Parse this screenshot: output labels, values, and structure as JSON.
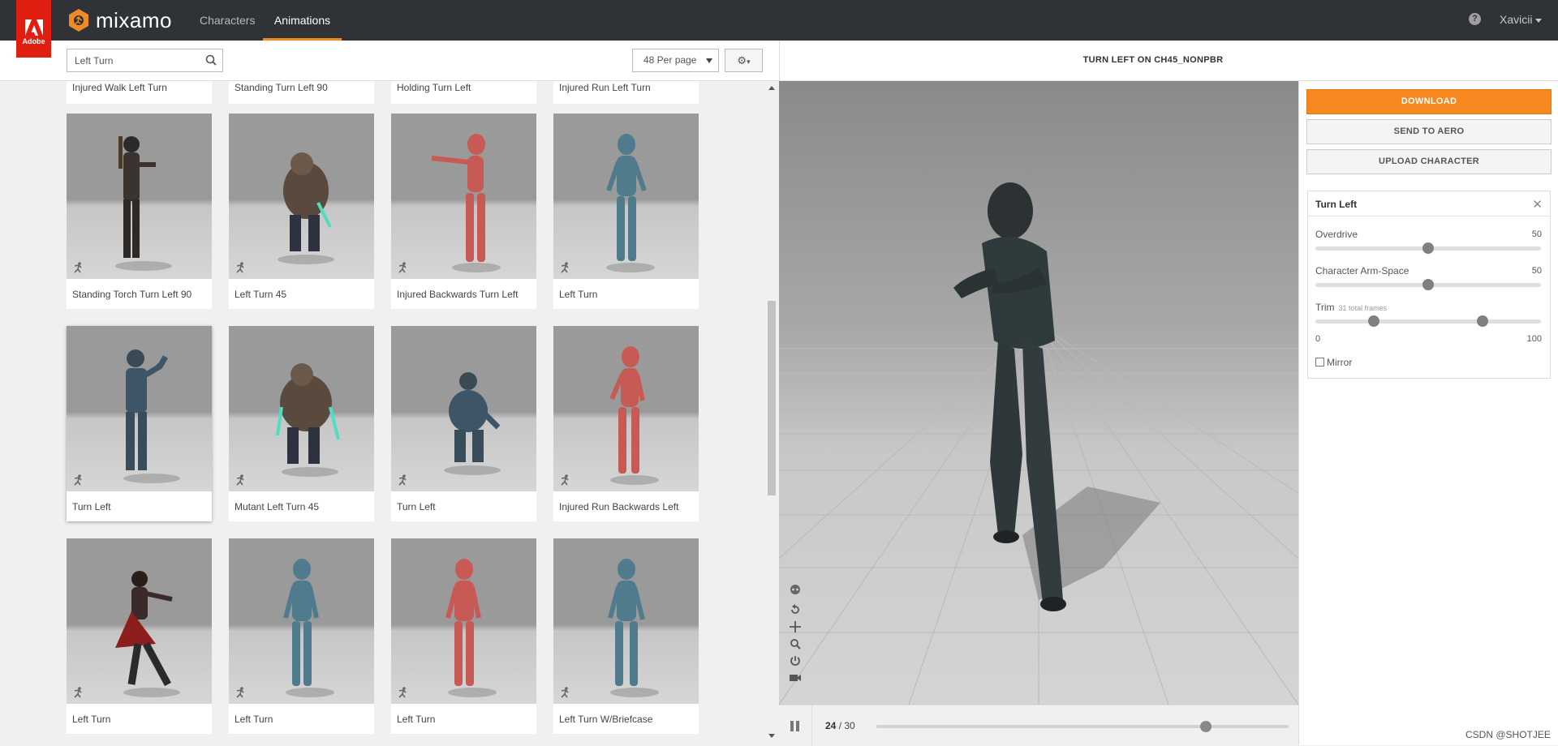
{
  "adobe": {
    "label": "Adobe"
  },
  "brand": {
    "name": "mixamo"
  },
  "nav": {
    "characters": "Characters",
    "animations": "Animations"
  },
  "user": {
    "help": "?",
    "name": "Xavicii"
  },
  "search": {
    "value": "Left Turn"
  },
  "per_page": {
    "value": "48 Per page"
  },
  "cards_partial": [
    "Injured Walk Left Turn",
    "Standing Turn Left 90",
    "Holding Turn Left",
    "Injured Run Left Turn"
  ],
  "cards": [
    {
      "label": "Standing Torch Turn Left 90"
    },
    {
      "label": "Left Turn 45"
    },
    {
      "label": "Injured Backwards Turn Left"
    },
    {
      "label": "Left Turn"
    },
    {
      "label": "Turn Left"
    },
    {
      "label": "Mutant Left Turn 45"
    },
    {
      "label": "Turn Left"
    },
    {
      "label": "Injured Run Backwards Left"
    },
    {
      "label": "Left Turn"
    },
    {
      "label": "Left Turn"
    },
    {
      "label": "Left Turn"
    },
    {
      "label": "Left Turn W/Briefcase"
    }
  ],
  "viewer": {
    "title": "TURN LEFT ON CH45_NONPBR"
  },
  "playback": {
    "current_frame": "24",
    "frames_suffix": " / 30",
    "progress": 0.8
  },
  "actions": {
    "download": "DOWNLOAD",
    "send_to_aero": "SEND TO AERO",
    "upload_character": "UPLOAD CHARACTER"
  },
  "params": {
    "title": "Turn Left",
    "overdrive": {
      "label": "Overdrive",
      "value": "50",
      "fraction": 0.5
    },
    "arm_space": {
      "label": "Character Arm-Space",
      "value": "50",
      "fraction": 0.5
    },
    "trim": {
      "label": "Trim",
      "sub": "31 total frames",
      "min": "0",
      "max": "100",
      "start": 0.26,
      "end": 0.74
    },
    "mirror": "Mirror"
  },
  "colors": {
    "accent": "#f7871f",
    "topbar": "#2f3236",
    "adobe_red": "#e01f10"
  },
  "watermark": "CSDN @SHOTJEE"
}
